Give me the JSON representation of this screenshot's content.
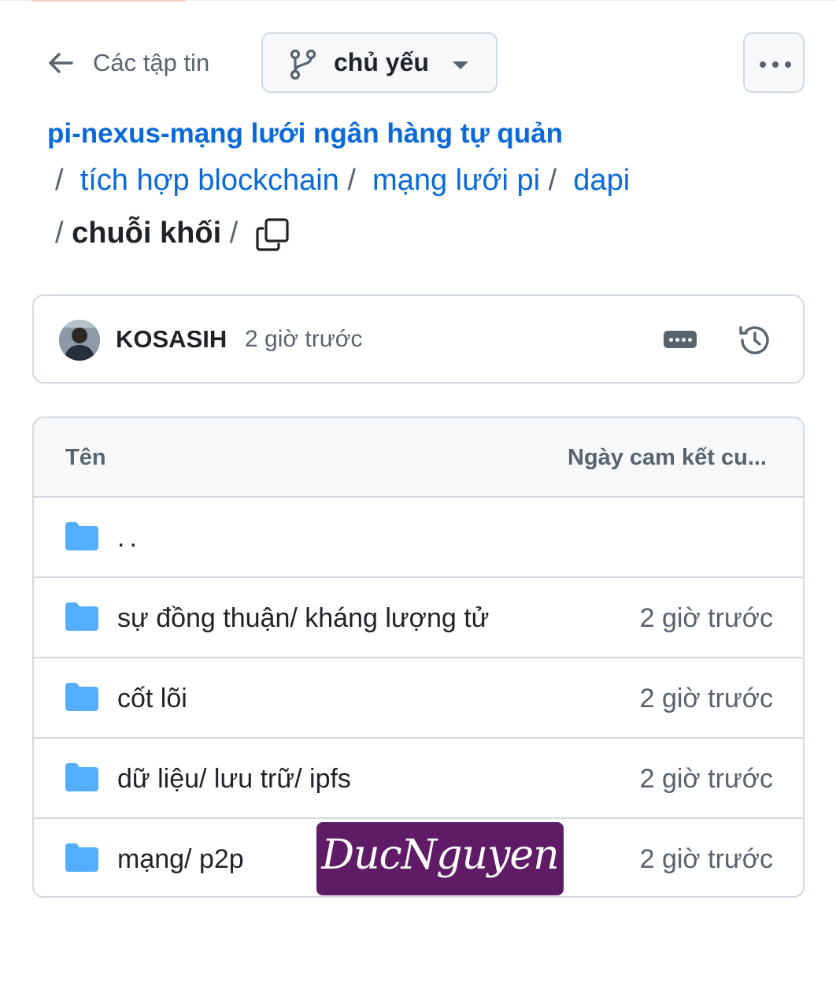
{
  "header": {
    "back_label": "Các tập tin",
    "branch_label": "chủ yếu"
  },
  "breadcrumb": {
    "repo": "pi-nexus-mạng lưới ngân hàng tự quản",
    "separator": "/",
    "links": [
      "tích hợp blockchain",
      "mạng lưới pi",
      "dapi"
    ],
    "current": "chuỗi khối"
  },
  "commit": {
    "author": "KOSASIH",
    "time": "2 giờ trước"
  },
  "table": {
    "col_name": "Tên",
    "col_date": "Ngày cam kết cu...",
    "rows": [
      {
        "name": "..",
        "date": ""
      },
      {
        "name": "sự đồng thuận/ kháng lượng tử",
        "date": "2 giờ trước"
      },
      {
        "name": "cốt lõi",
        "date": "2 giờ trước"
      },
      {
        "name": "dữ liệu/ lưu trữ/ ipfs",
        "date": "2 giờ trước"
      },
      {
        "name": "mạng/ p2p",
        "date": "2 giờ trước"
      }
    ]
  },
  "watermark": "DucNguyen",
  "colors": {
    "link": "#0969da",
    "folder": "#54aeff",
    "muted": "#59636e",
    "border": "#d1d9e0",
    "watermark_bg": "#5f1b66"
  },
  "icons": [
    "arrow-left-icon",
    "git-branch-icon",
    "caret-down-icon",
    "kebab-horizontal-icon",
    "copy-icon",
    "history-icon",
    "folder-icon"
  ]
}
